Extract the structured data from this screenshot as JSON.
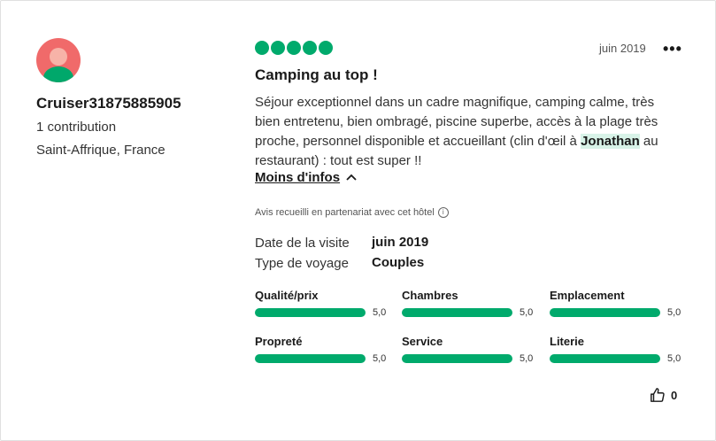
{
  "user": {
    "name": "Cruiser31875885905",
    "contributions": "1 contribution",
    "location": "Saint-Affrique, France"
  },
  "review": {
    "rating": 5,
    "date": "juin 2019",
    "title": "Camping au top !",
    "text_before": "Séjour exceptionnel dans un cadre magnifique, camping calme, très bien entretenu, bien ombragé, piscine superbe, accès à la plage très proche,  personnel disponible et accueillant (clin d'œil à ",
    "highlight": "Jonathan",
    "text_after": " au restaurant) : tout est super !!",
    "less_label": "Moins d'infos",
    "partner_note": "Avis recueilli en partenariat avec cet hôtel",
    "visit_date_label": "Date de la visite",
    "visit_date_value": "juin 2019",
    "trip_type_label": "Type de voyage",
    "trip_type_value": "Couples"
  },
  "subratings": [
    {
      "label": "Qualité/prix",
      "score": "5,0",
      "value": 5.0
    },
    {
      "label": "Chambres",
      "score": "5,0",
      "value": 5.0
    },
    {
      "label": "Emplacement",
      "score": "5,0",
      "value": 5.0
    },
    {
      "label": "Propreté",
      "score": "5,0",
      "value": 5.0
    },
    {
      "label": "Service",
      "score": "5,0",
      "value": 5.0
    },
    {
      "label": "Literie",
      "score": "5,0",
      "value": 5.0
    }
  ],
  "helpful_count": "0",
  "colors": {
    "accent": "#00aa6c",
    "highlight_bg": "#d8f3e8",
    "avatar_bg": "#f06a6a"
  },
  "icons": {
    "menu": "more-horizontal-icon",
    "chevron": "chevron-up-icon",
    "info": "info-icon",
    "thumbs_up": "thumbs-up-icon"
  }
}
